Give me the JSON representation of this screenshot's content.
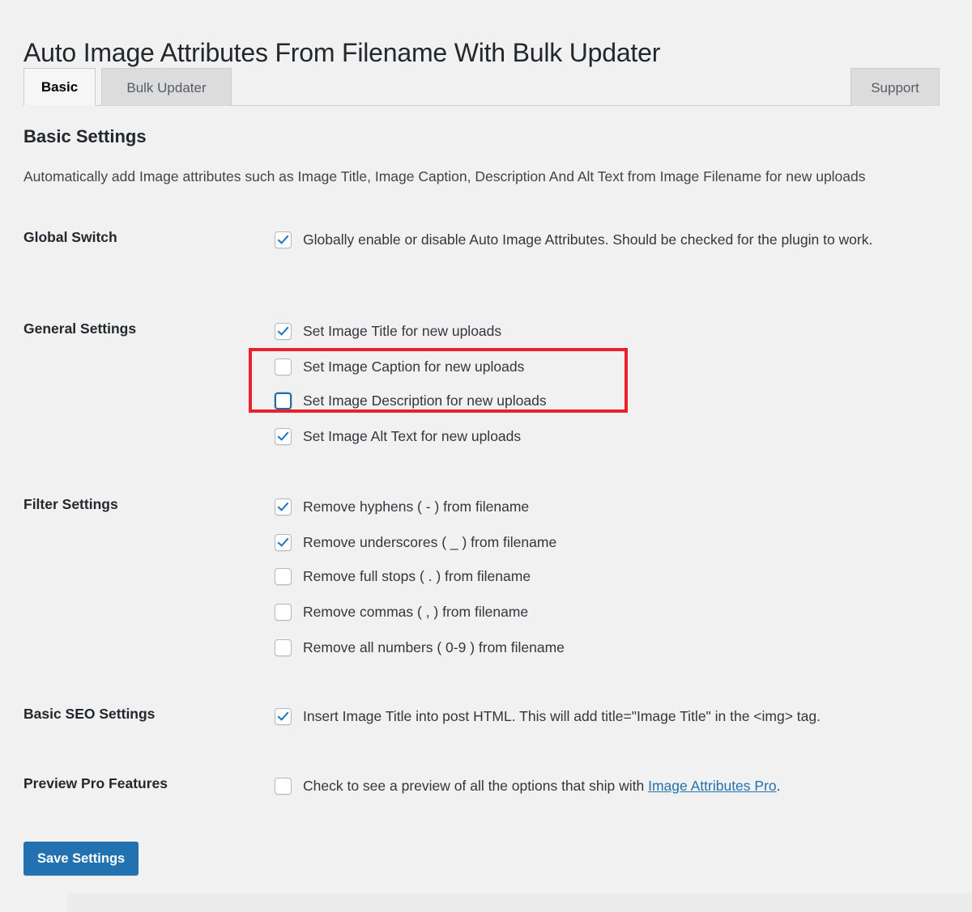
{
  "header": {
    "title": "Auto Image Attributes From Filename With Bulk Updater"
  },
  "tabs": [
    {
      "label": "Basic",
      "state": "active"
    },
    {
      "label": "Bulk Updater",
      "state": "inactive"
    },
    {
      "label": "Support",
      "state": "inactive"
    }
  ],
  "section": {
    "heading": "Basic Settings",
    "description": "Automatically add Image attributes such as Image Title, Image Caption, Description And Alt Text from Image Filename for new uploads"
  },
  "rows": {
    "global_switch": {
      "label": "Global Switch",
      "options": [
        {
          "label": "Globally enable or disable Auto Image Attributes. Should be checked for the plugin to work.",
          "checked": true,
          "focused": false
        }
      ]
    },
    "general_settings": {
      "label": "General Settings",
      "options": [
        {
          "label": "Set Image Title for new uploads",
          "checked": true,
          "focused": false
        },
        {
          "label": "Set Image Caption for new uploads",
          "checked": false,
          "focused": false
        },
        {
          "label": "Set Image Description for new uploads",
          "checked": false,
          "focused": true
        },
        {
          "label": "Set Image Alt Text for new uploads",
          "checked": true,
          "focused": false
        }
      ]
    },
    "filter_settings": {
      "label": "Filter Settings",
      "options": [
        {
          "label": "Remove hyphens ( - ) from filename",
          "checked": true,
          "focused": false
        },
        {
          "label": "Remove underscores ( _ ) from filename",
          "checked": true,
          "focused": false
        },
        {
          "label": "Remove full stops ( . ) from filename",
          "checked": false,
          "focused": false
        },
        {
          "label": "Remove commas ( , ) from filename",
          "checked": false,
          "focused": false
        },
        {
          "label": "Remove all numbers ( 0-9 ) from filename",
          "checked": false,
          "focused": false
        }
      ]
    },
    "basic_seo_settings": {
      "label": "Basic SEO Settings",
      "options": [
        {
          "label": "Insert Image Title into post HTML. This will add title=\"Image Title\" in the <img> tag.",
          "checked": true,
          "focused": false
        }
      ]
    },
    "preview_pro_features": {
      "label": "Preview Pro Features",
      "option_prefix": "Check to see a preview of all the options that ship with ",
      "option_link": "Image Attributes Pro",
      "option_suffix": ".",
      "checked": false,
      "focused": false
    }
  },
  "footer": {
    "save_label": "Save Settings"
  },
  "colors": {
    "accent": "#2271b1",
    "highlight": "#e8212b",
    "check": "#1e73be",
    "background": "#f1f1f1"
  }
}
